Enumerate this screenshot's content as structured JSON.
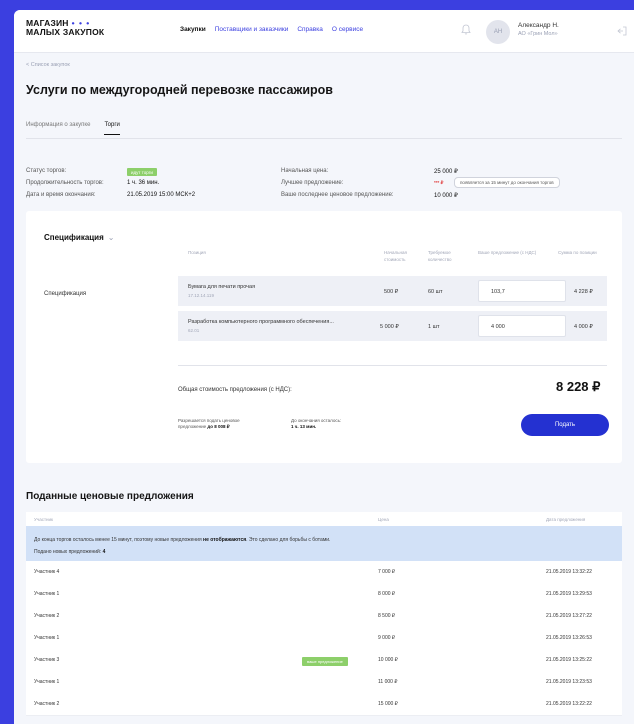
{
  "header": {
    "logo_line1": "МАГАЗИН",
    "logo_dots": "• • •",
    "logo_line2": "МАЛЫХ ЗАКУПОК",
    "nav": [
      "Закупки",
      "Поставщики и заказчики",
      "Справка",
      "О сервисе"
    ],
    "user_name": "Александр Н.",
    "user_org": "АО «Грин Мол»",
    "avatar_initials": "АН"
  },
  "breadcrumb": "< Список закупок",
  "page_title": "Услуги по междугородней перевозке пассажиров",
  "tabs": [
    "Информация о закупке",
    "Торги"
  ],
  "info": {
    "status_label": "Статус торгов:",
    "status_value": "идут торги",
    "duration_label": "Продолжительность торгов:",
    "duration_value": "1 ч. 36 мин.",
    "end_label": "Дата и время окончания:",
    "end_value": "21.05.2019 15:00  МСК+2",
    "start_price_label": "Начальная цена:",
    "start_price_value": "25 000 ₽",
    "best_label": "Лучшее предложение:",
    "best_value": "*** ₽",
    "best_hint": "появляется за 15 минут до окончания торгов",
    "last_label": "Ваше последнее ценовое предложение:",
    "last_value": "10 000 ₽"
  },
  "spec": {
    "title": "Спецификация",
    "chevron": "⌄",
    "label": "Спецификация",
    "columns": [
      "Позиция",
      "Начальная стоимость",
      "Требуемое количество",
      "Ваше предложение (с НДС)",
      "Сумма по позиции"
    ],
    "rows": [
      {
        "name": "Бумага для печати прочая",
        "code": "17.12.14.119",
        "start": "500 ₽",
        "qty": "60 шт",
        "offer": "103,7",
        "sum": "4 228 ₽"
      },
      {
        "name": "Разработка компьютерного программного обеспечения...",
        "code": "62.01",
        "start": "5 000 ₽",
        "qty": "1 шт",
        "offer": "4 000",
        "sum": "4 000 ₽"
      }
    ],
    "total_label": "Общая стоимость предложения (с НДС):",
    "total_value": "8 228 ₽",
    "note1_line1": "Разрешается подать ценовое",
    "note1_line2": "предложение",
    "note1_bold": "до 8 008 ₽",
    "note2_line1": "До окончания осталось:",
    "note2_bold": "1 ч. 13 мин.",
    "submit": "Подать"
  },
  "bids": {
    "title": "Поданные ценовые предложения",
    "columns": [
      "Участник",
      "Цена",
      "Дата предложения"
    ],
    "alert_line1": "До конца торгов осталось менее 15 минут, поэтому новые предложения",
    "alert_bold": "не отображаются",
    "alert_line1_end": ". Это сделано для борьбы с ботами.",
    "alert_line2": "Подано новых предложений:",
    "alert_count": "4",
    "your_offer_tag": "ваше предложение",
    "rows": [
      {
        "participant": "Участник 4",
        "price": "7 000 ₽",
        "date": "21.05.2019 13:32:22"
      },
      {
        "participant": "Участник 1",
        "price": "8 000 ₽",
        "date": "21.05.2019 13:29:53"
      },
      {
        "participant": "Участник 2",
        "price": "8 500 ₽",
        "date": "21.05.2019 13:27:22"
      },
      {
        "participant": "Участник 1",
        "price": "9 000 ₽",
        "date": "21.05.2019 13:26:53"
      },
      {
        "participant": "Участник 3",
        "price": "10 000 ₽",
        "date": "21.05.2019 13:25:22"
      },
      {
        "participant": "Участник 1",
        "price": "11 000 ₽",
        "date": "21.05.2019 13:23:53"
      },
      {
        "participant": "Участник 2",
        "price": "15 000 ₽",
        "date": "21.05.2019 13:22:22"
      }
    ]
  }
}
